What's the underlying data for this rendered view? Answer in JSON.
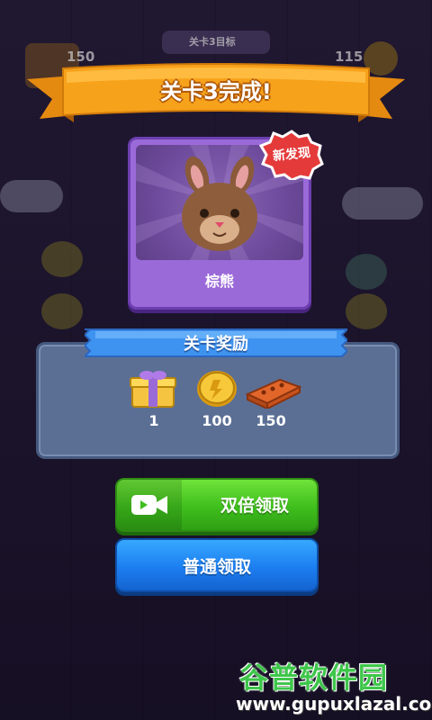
{
  "level": {
    "title": "关卡3完成!",
    "top_badge_left": "150",
    "top_badge_right": "115",
    "top_goal_label": "关卡3目标"
  },
  "unlock": {
    "badge": "新发现",
    "character_name": "棕熊"
  },
  "rewards": {
    "header": "关卡奖励",
    "items": [
      {
        "icon": "gift-icon",
        "count": "1"
      },
      {
        "icon": "coin-icon",
        "count": "100"
      },
      {
        "icon": "brick-icon",
        "count": "150"
      }
    ]
  },
  "buttons": {
    "double_claim": "双倍领取",
    "normal_claim": "普通领取"
  },
  "watermark": {
    "brand": "谷普软件园",
    "url": "www.gupuxlazal.com"
  },
  "colors": {
    "ribbon": "#f7a21b",
    "card": "#9b6ad9",
    "green_button": "#3fbe1d",
    "blue_button": "#1c7ef0"
  }
}
